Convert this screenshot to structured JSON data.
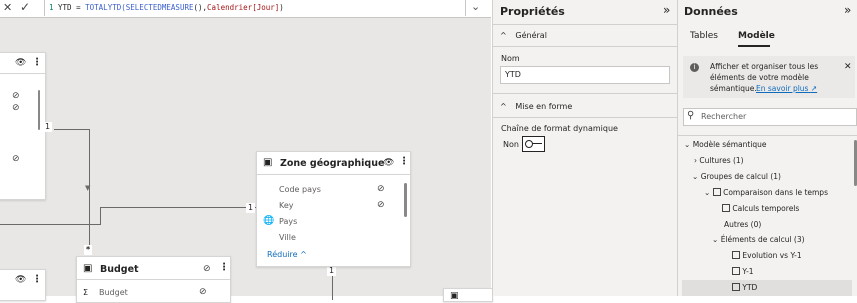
{
  "formula": {
    "cancel_icon": "close-icon",
    "commit_icon": "check-icon",
    "line_number": "1",
    "measure_name": "YTD",
    "equals": " = ",
    "fn1": "TOTALYTD(",
    "fn2": "SELECTEDMEASURE",
    "paren": "(),",
    "col": "Calendrier[Jour]",
    "close": ")"
  },
  "canvas": {
    "zone_card": {
      "title": "Zone géographique",
      "fields": [
        "Code pays",
        "Key",
        "Pays",
        "Ville"
      ],
      "collapse_label": "Réduire"
    },
    "budget_card": {
      "title": "Budget",
      "fields": [
        "Budget"
      ]
    },
    "relationships": {
      "one_label_a": "1",
      "one_label_b": "1",
      "one_label_c": "1",
      "many_label": "*"
    }
  },
  "properties": {
    "title": "Propriétés",
    "section_general": "Général",
    "name_label": "Nom",
    "name_value": "YTD",
    "section_format": "Mise en forme",
    "dynamic_format_label": "Chaîne de format dynamique",
    "toggle_state": "Non"
  },
  "data_pane": {
    "title": "Données",
    "tabs": [
      "Tables",
      "Modèle"
    ],
    "active_tab": "Modèle",
    "info_text_1": "Afficher et organiser tous les",
    "info_text_2": "éléments de votre modèle",
    "info_text_3": "sémantique.",
    "info_link": "En savoir plus",
    "search_placeholder": "Rechercher",
    "tree": {
      "root": "Modèle sémantique",
      "cultures": "Cultures (1)",
      "calc_groups": "Groupes de calcul (1)",
      "group": "Comparaison dans le temps",
      "calc_col": "Calculs temporels",
      "others": "Autres (0)",
      "items_hdr": "Éléments de calcul (3)",
      "items": [
        "Evolution vs Y-1",
        "Y-1",
        "YTD"
      ]
    }
  },
  "colors": {
    "accent_tab": "#252423",
    "link": "#0f6cbd",
    "selected_row": "#e1dfdd"
  }
}
